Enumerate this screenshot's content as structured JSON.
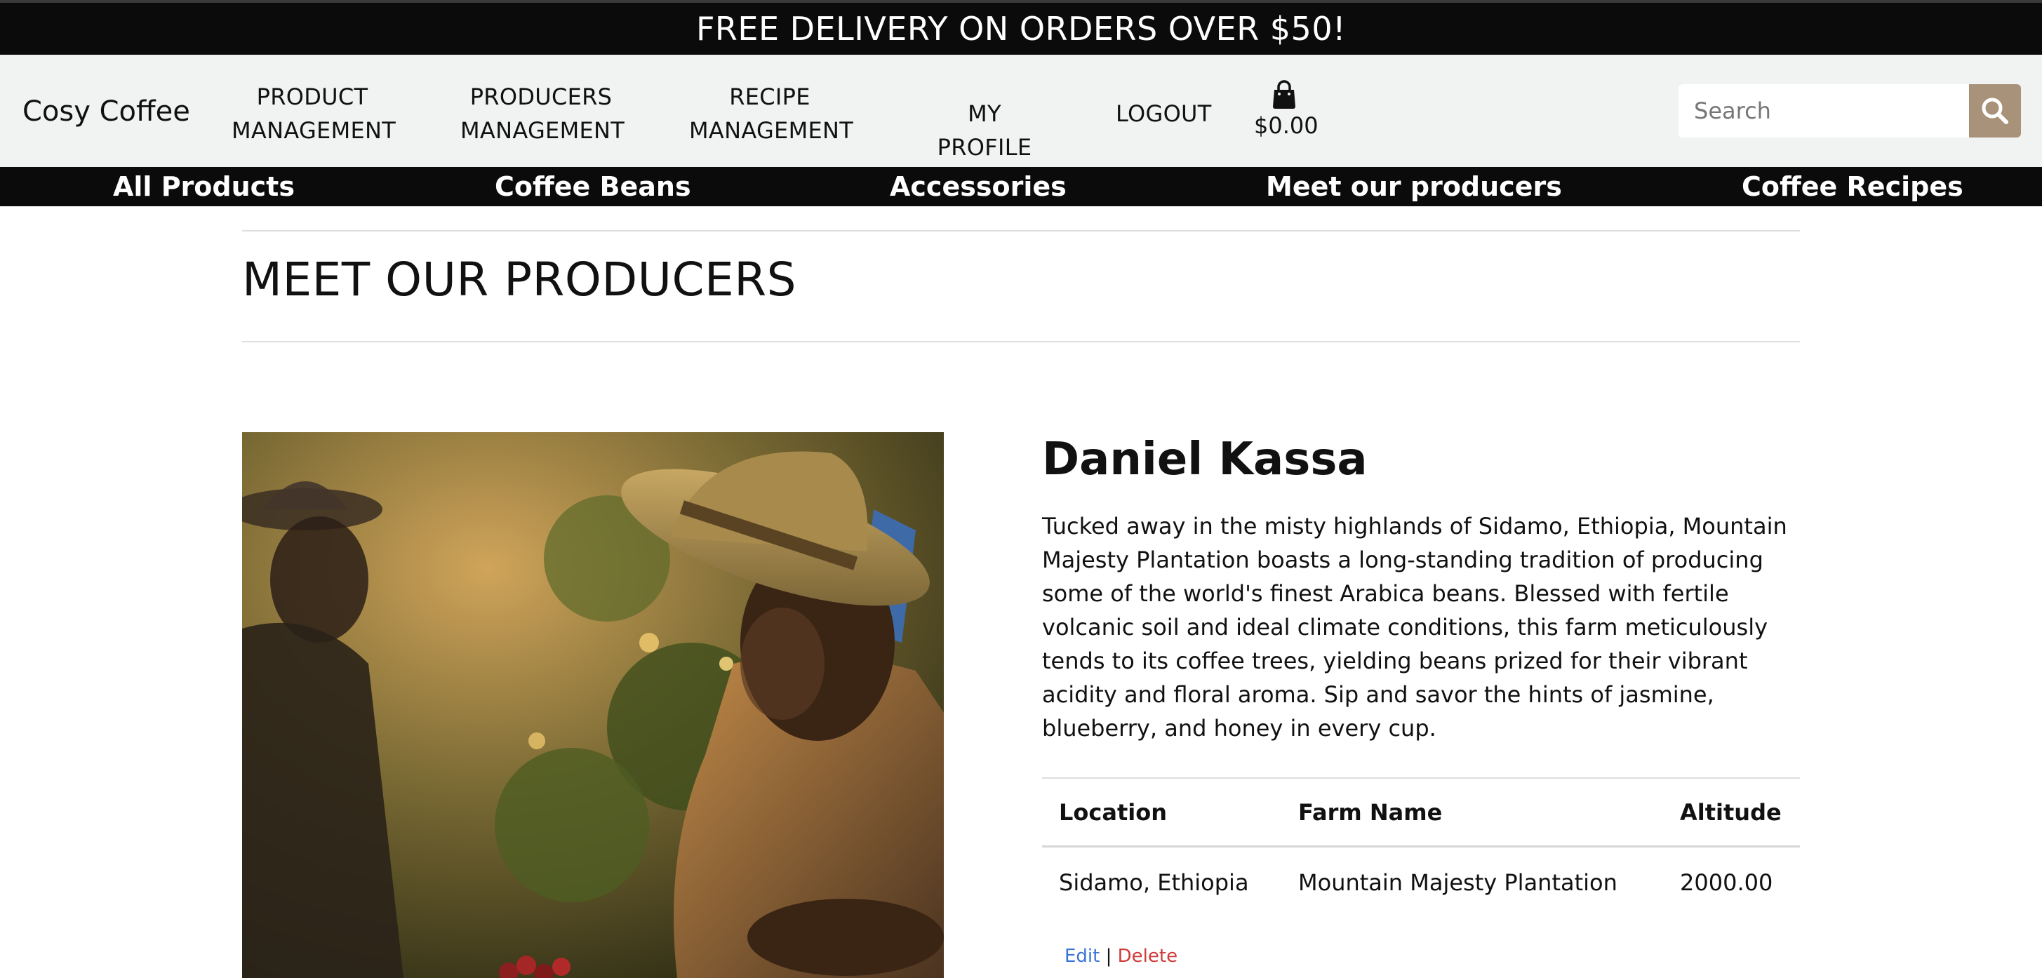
{
  "banner": {
    "text": "FREE DELIVERY ON ORDERS OVER $50!"
  },
  "navbar": {
    "brand": "Cosy Coffee",
    "items": [
      {
        "line1": "PRODUCT",
        "line2": "MANAGEMENT"
      },
      {
        "line1": "PRODUCERS",
        "line2": "MANAGEMENT"
      },
      {
        "line1": "RECIPE",
        "line2": "MANAGEMENT"
      },
      {
        "label": "MY PROFILE"
      },
      {
        "label": "LOGOUT"
      }
    ],
    "cart": {
      "icon": "shopping-bag-icon",
      "total": "$0.00"
    },
    "search": {
      "placeholder": "Search",
      "value": "",
      "icon": "search-icon"
    }
  },
  "categories": [
    "All Products",
    "Coffee Beans",
    "Accessories",
    "Meet our producers",
    "Coffee Recipes"
  ],
  "page": {
    "title": "MEET OUR PRODUCERS"
  },
  "producer": {
    "name": "Daniel Kassa",
    "description": "Tucked away in the misty highlands of Sidamo, Ethiopia, Mountain Majesty Plantation boasts a long-standing tradition of producing some of the world's finest Arabica beans. Blessed with fertile volcanic soil and ideal climate conditions, this farm meticulously tends to its coffee trees, yielding beans prized for their vibrant acidity and floral aroma. Sip and savor the hints of jasmine, blueberry, and honey in every cup.",
    "table": {
      "headers": [
        "Location",
        "Farm Name",
        "Altitude"
      ],
      "row": [
        "Sidamo, Ethiopia",
        "Mountain Majesty Plantation",
        "2000.00"
      ]
    },
    "actions": {
      "edit": "Edit",
      "separator": "|",
      "delete": "Delete"
    }
  },
  "colors": {
    "banner_bg": "#0b0b0b",
    "navbar_bg": "#f1f3f2",
    "search_button": "#a8927a",
    "edit_link": "#3b74d8",
    "delete_link": "#d03b3b"
  }
}
